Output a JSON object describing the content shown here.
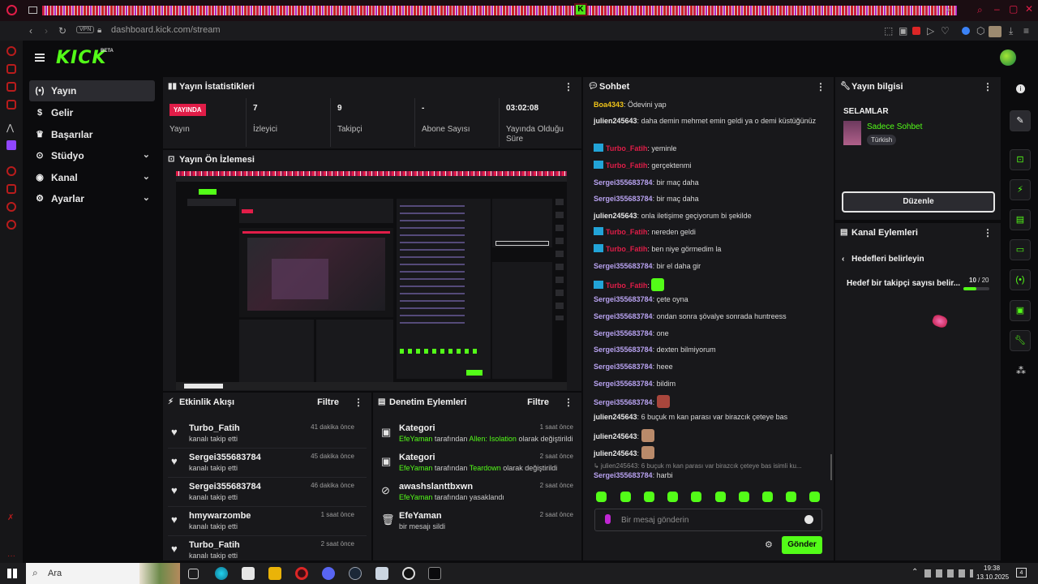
{
  "browser": {
    "url": "dashboard.kick.com/stream",
    "vpn_label": "VPN"
  },
  "kick": {
    "logo": "KICK",
    "beta": "BETA"
  },
  "nav": [
    {
      "label": "Yayın",
      "icon": "broadcast-icon",
      "active": true
    },
    {
      "label": "Gelir",
      "icon": "dollar-icon"
    },
    {
      "label": "Başarılar",
      "icon": "trophy-icon"
    },
    {
      "label": "Stüdyo",
      "icon": "studio-icon",
      "expand": true
    },
    {
      "label": "Kanal",
      "icon": "channel-icon",
      "expand": true
    },
    {
      "label": "Ayarlar",
      "icon": "gear-icon",
      "expand": true
    }
  ],
  "stats": {
    "title": "Yayın İstatistikleri",
    "live_badge": "YAYINDA",
    "items": [
      {
        "value": "",
        "label": "Yayın"
      },
      {
        "value": "7",
        "label": "İzleyici"
      },
      {
        "value": "9",
        "label": "Takipçi"
      },
      {
        "value": "-",
        "label": "Abone Sayısı"
      },
      {
        "value": "03:02:08",
        "label": "Yayında Olduğu Süre"
      }
    ]
  },
  "preview": {
    "title": "Yayın Ön İzlemesi"
  },
  "activity": {
    "title": "Etkinlik Akışı",
    "filter": "Filtre",
    "items": [
      {
        "name": "Turbo_Fatih",
        "sub": "kanalı takip etti",
        "time": "41 dakika önce"
      },
      {
        "name": "Sergei355683784",
        "sub": "kanalı takip etti",
        "time": "45 dakika önce"
      },
      {
        "name": "Sergei355683784",
        "sub": "kanalı takip etti",
        "time": "46 dakika önce"
      },
      {
        "name": "hmywarzombe",
        "sub": "kanalı takip etti",
        "time": "1 saat önce"
      },
      {
        "name": "Turbo_Fatih",
        "sub": "kanalı takip etti",
        "time": "2 saat önce"
      }
    ]
  },
  "moderation": {
    "title": "Denetim Eylemleri",
    "filter": "Filtre",
    "items": [
      {
        "name": "Kategori",
        "actor": "EfeYaman",
        "mid": " tarafından ",
        "target": "Allen: Isolation",
        "end": " olarak değiştirildi",
        "time": "1 saat önce",
        "icon": "category-icon"
      },
      {
        "name": "Kategori",
        "actor": "EfeYaman",
        "mid": " tarafından ",
        "target": "Teardown",
        "end": " olarak değiştirildi",
        "time": "2 saat önce",
        "icon": "category-icon"
      },
      {
        "name": "awashslanttbxwn",
        "actor": "EfeYaman",
        "mid": " tarafından yasaklandı",
        "target": "",
        "end": "",
        "time": "2 saat önce",
        "icon": "ban-icon"
      },
      {
        "name": "EfeYaman",
        "actor": "",
        "mid": "bir mesajı sildi",
        "target": "",
        "end": "",
        "time": "2 saat önce",
        "icon": "trash-icon"
      }
    ]
  },
  "chat": {
    "title": "Sohbet",
    "placeholder": "Bir mesaj gönderin",
    "send": "Gönder",
    "reply_preview": "↳ julien245643: 6 buçuk m kan parası var birazcık çeteye bas isimli ku...",
    "messages": [
      {
        "user": "Boa4343",
        "color": "#f0c419",
        "text": "Ödevini yap"
      },
      {
        "user": "julien245643",
        "color": "#e8e8e8",
        "text": "daha demin mehmet emin geldi ya o demi küstüğünüz"
      },
      {
        "user": "Turbo_Fatih",
        "color": "#e11d48",
        "text": "yeminle",
        "badge": true
      },
      {
        "user": "Turbo_Fatih",
        "color": "#e11d48",
        "text": "gerçektenmi",
        "badge": true
      },
      {
        "user": "Sergei355683784",
        "color": "#b8a2f0",
        "text": "bir maç daha"
      },
      {
        "user": "Sergei355683784",
        "color": "#b8a2f0",
        "text": "bir maç daha"
      },
      {
        "user": "julien245643",
        "color": "#e8e8e8",
        "text": "onla iletişime geçiyorum bi şekilde"
      },
      {
        "user": "Turbo_Fatih",
        "color": "#e11d48",
        "text": "nereden geldi",
        "badge": true
      },
      {
        "user": "Turbo_Fatih",
        "color": "#e11d48",
        "text": "ben niye görmedim la",
        "badge": true
      },
      {
        "user": "Sergei355683784",
        "color": "#b8a2f0",
        "text": "bir el daha gir"
      },
      {
        "user": "Turbo_Fatih",
        "color": "#e11d48",
        "text": "",
        "badge": true,
        "emote": "#53fc18"
      },
      {
        "user": "Sergei355683784",
        "color": "#b8a2f0",
        "text": "çete oyna"
      },
      {
        "user": "Sergei355683784",
        "color": "#b8a2f0",
        "text": "ondan sonra şövalye sonrada huntreess"
      },
      {
        "user": "Sergei355683784",
        "color": "#b8a2f0",
        "text": "one"
      },
      {
        "user": "Sergei355683784",
        "color": "#b8a2f0",
        "text": "dexten bilmiyorum"
      },
      {
        "user": "Sergei355683784",
        "color": "#b8a2f0",
        "text": "heee"
      },
      {
        "user": "Sergei355683784",
        "color": "#b8a2f0",
        "text": "bildim"
      },
      {
        "user": "Sergei355683784",
        "color": "#b8a2f0",
        "text": "",
        "emote": "#a8463c"
      },
      {
        "user": "julien245643",
        "color": "#e8e8e8",
        "text": "6 buçuk m kan parası var birazcık çeteye bas"
      },
      {
        "user": "julien245643",
        "color": "#e8e8e8",
        "text": "",
        "emote": "#b98a6a"
      },
      {
        "user": "julien245643",
        "color": "#e8e8e8",
        "text": "",
        "emote": "#b98a6a"
      },
      {
        "user": "Sergei355683784",
        "color": "#b8a2f0",
        "text": "harbi"
      }
    ]
  },
  "info": {
    "title": "Yayın bilgisi",
    "stream_title": "SELAMLAR",
    "category": "Sadece Sohbet",
    "language": "Türkish",
    "edit": "Düzenle"
  },
  "actions": {
    "title": "Kanal Eylemleri",
    "back": "Hedefleri belirleyin",
    "goal": "Hedef bir takipçi sayısı belir...",
    "goal_current": "10",
    "goal_total": "/ 20",
    "goal_progress": 0.5
  },
  "taskbar": {
    "search": "Ara",
    "time": "19:38",
    "date": "13.10.2025",
    "notif": "4"
  },
  "colors": {
    "accent": "#53fc18",
    "live": "#e11d48",
    "panel": "#18181b"
  }
}
